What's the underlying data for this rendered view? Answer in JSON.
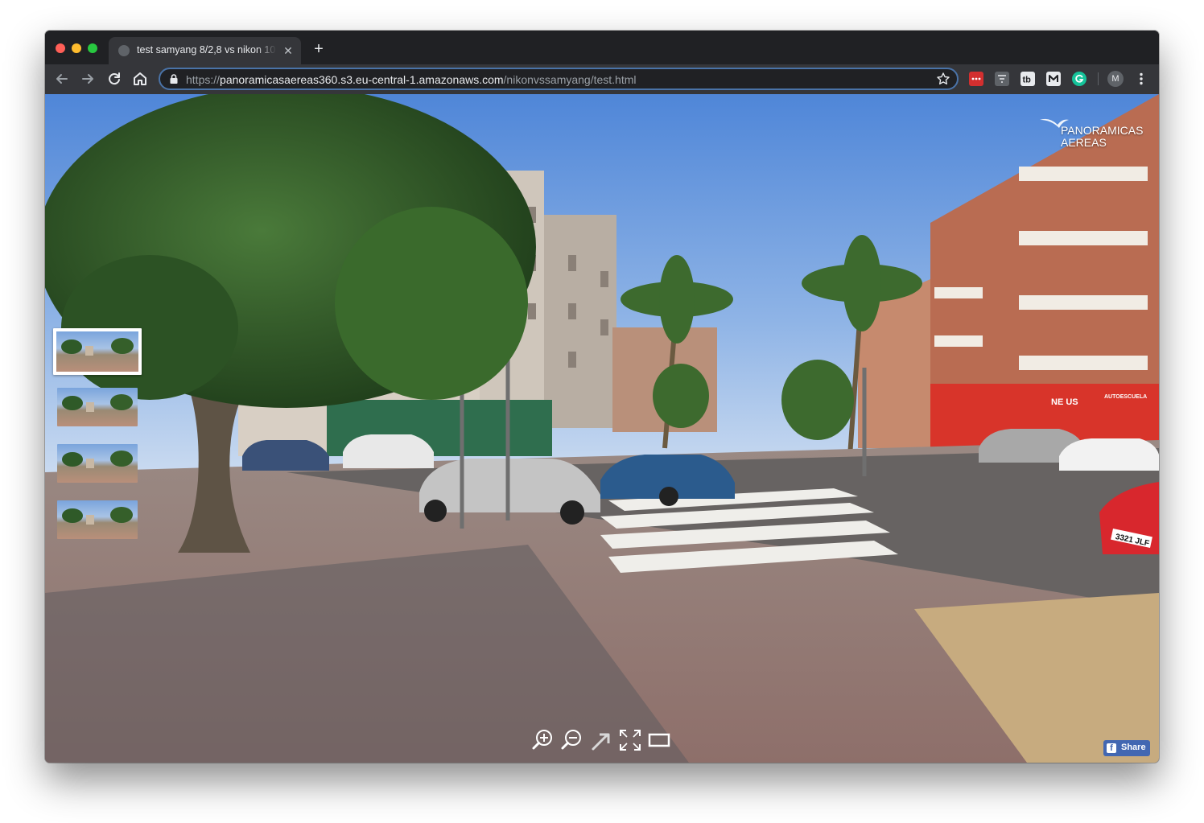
{
  "browser": {
    "tab": {
      "title": "test samyang 8/2,8 vs nikon 10",
      "close_glyph": "✕"
    },
    "new_tab_glyph": "+",
    "address": {
      "scheme": "https://",
      "host": "panoramicasaereas360.s3.eu-central-1.amazonaws.com",
      "path": "/nikonvssamyang/test.html"
    },
    "profile_initial": "M",
    "extensions": [
      "lastpass-icon",
      "filter-extension-icon",
      "tb-extension-icon",
      "m-extension-icon",
      "grammarly-icon"
    ],
    "colors": {
      "frame": "#202124",
      "toolbar": "#35363a",
      "omnibox_focus": "#4a73a8"
    }
  },
  "viewer": {
    "logo": {
      "line1": "PANORAMICAS",
      "line2": "AEREAS"
    },
    "thumbnails": [
      "panorama-1",
      "panorama-2",
      "panorama-3",
      "panorama-4"
    ],
    "active_thumbnail": 0,
    "controls": [
      "zoom-in-icon",
      "zoom-out-icon",
      "autorotate-icon",
      "fullscreen-icon",
      "vr-mode-icon"
    ],
    "share_label": "Share",
    "share_color": "#4267b2",
    "scene_text": {
      "shop_sign": "NE US",
      "shop_sign_2": "AUTOESCUELA",
      "plate_1": "3321 JLF"
    }
  }
}
